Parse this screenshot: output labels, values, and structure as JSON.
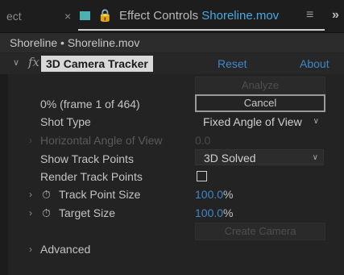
{
  "tabbar": {
    "prev_tab_text": "ect",
    "close_glyph": "×",
    "swatch_color": "#4bb1b3",
    "lock_icon": "lock-icon",
    "title_prefix": "Effect Controls",
    "title_file": "Shoreline.mov",
    "menu_glyph": "≡",
    "overflow_glyph": "»"
  },
  "breadcrumb": "Shoreline • Shoreline.mov",
  "effect": {
    "name": "3D Camera Tracker",
    "reset_label": "Reset",
    "about_label": "About"
  },
  "rows": {
    "analyze_label": "Analyze",
    "progress_text": "0% (frame 1 of 464)",
    "cancel_label": "Cancel",
    "shot_type_label": "Shot Type",
    "shot_type_value": "Fixed Angle of View",
    "horizontal_aov_label": "Horizontal Angle of View",
    "horizontal_aov_value": "0.0",
    "show_track_points_label": "Show Track Points",
    "show_track_points_value": "3D Solved",
    "render_track_points_label": "Render Track Points",
    "render_track_points_checked": false,
    "track_point_size_label": "Track Point Size",
    "track_point_size_value": "100.0",
    "track_point_size_unit": "%",
    "target_size_label": "Target Size",
    "target_size_value": "100.0",
    "target_size_unit": "%",
    "create_camera_label": "Create Camera",
    "advanced_label": "Advanced"
  },
  "colors": {
    "accent_link": "#3e88c8",
    "panel_bg": "#232323"
  }
}
